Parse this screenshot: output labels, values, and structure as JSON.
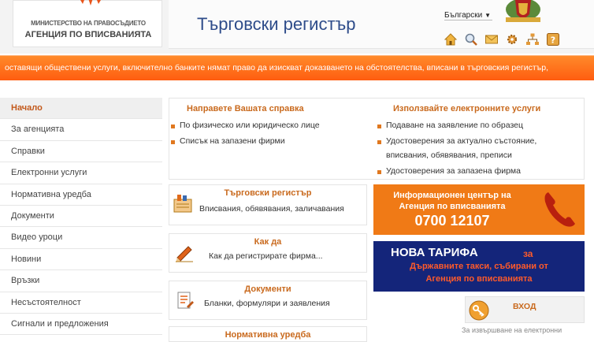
{
  "header": {
    "logo_line1": "МИНИСТЕРСТВО НА ПРАВОСЪДИЕТО",
    "logo_line2": "АГЕНЦИЯ ПО ВПИСВАНИЯТА",
    "site_title": "Търговски регистър",
    "language": "Български",
    "toolbar_icons": [
      "home-icon",
      "search-icon",
      "mail-icon",
      "settings-icon",
      "sitemap-icon",
      "help-icon"
    ]
  },
  "ticker": {
    "text": "оставящи обществени услуги, включително банките нямат право да изискват доказването на обстоятелства, вписани в търговския регистър,"
  },
  "sidebar": {
    "items": [
      {
        "label": "Начало",
        "active": true
      },
      {
        "label": "За агенцията"
      },
      {
        "label": "Справки"
      },
      {
        "label": "Електронни услуги"
      },
      {
        "label": "Нормативна уредба"
      },
      {
        "label": "Документи"
      },
      {
        "label": "Видео уроци"
      },
      {
        "label": "Новини"
      },
      {
        "label": "Връзки"
      },
      {
        "label": "Несъстоятелност"
      },
      {
        "label": "Сигнали и предложения"
      }
    ]
  },
  "inquiry": {
    "title": "Направете Вашата справка",
    "items": [
      "По физическо или юридическо лице",
      "Списък на запазени фирми"
    ]
  },
  "eservices": {
    "title": "Използвайте електронните услуги",
    "item1": "Подаване на заявление по образец",
    "item2_line1": "Удостоверения за актуално състояние,",
    "item2_line2": "вписвания, обявявания, преписи",
    "item3": "Удостоверения за запазена фирма"
  },
  "cards": [
    {
      "title": "Търговски регистър",
      "subtitle": "Вписвания, обявявания, заличавания"
    },
    {
      "title": "Как да",
      "subtitle": "Как да регистрирате фирма..."
    },
    {
      "title": "Документи",
      "subtitle": "Бланки, формуляри и заявления"
    },
    {
      "title": "Нормативна уредба"
    }
  ],
  "info_banner": {
    "line1": "Информационен център на",
    "line2": "Агенция по вписванията",
    "phone": "0700 12107"
  },
  "tariff_banner": {
    "main": "НОВА ТАРИФА",
    "za": "за",
    "line2": "Държавните такси, събирани от",
    "line3": "Агенция по вписванията"
  },
  "login": {
    "title": "ВХОД",
    "note": "За извършване на електронни"
  },
  "colors": {
    "accent_orange": "#f07a16",
    "navy": "#14257a",
    "title_blue": "#2e4c8a"
  }
}
